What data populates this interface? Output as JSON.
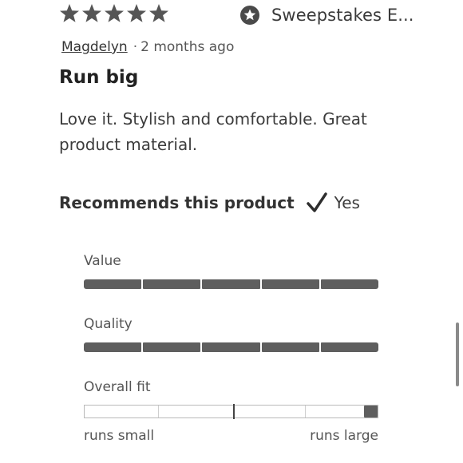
{
  "review": {
    "rating": 5,
    "rating_max": 5,
    "star_color": "#555555",
    "badge": {
      "icon": "star-circle-icon",
      "label": "Sweepstakes E..."
    },
    "author": "Magdelyn",
    "separator": "·",
    "time_ago": "2 months ago",
    "title": "Run big",
    "body": "Love it. Stylish and comfortable. Great product material.",
    "recommend": {
      "label": "Recommends this product",
      "icon": "checkmark-icon",
      "value": "Yes"
    }
  },
  "ratings": {
    "value": {
      "label": "Value",
      "score": 5,
      "max": 5
    },
    "quality": {
      "label": "Quality",
      "score": 5,
      "max": 5
    },
    "fit": {
      "label": "Overall fit",
      "position_fraction": 1.0,
      "min_label": "runs small",
      "max_label": "runs large"
    }
  },
  "colors": {
    "bar_fill": "#5e5e5e",
    "text": "#333333"
  }
}
